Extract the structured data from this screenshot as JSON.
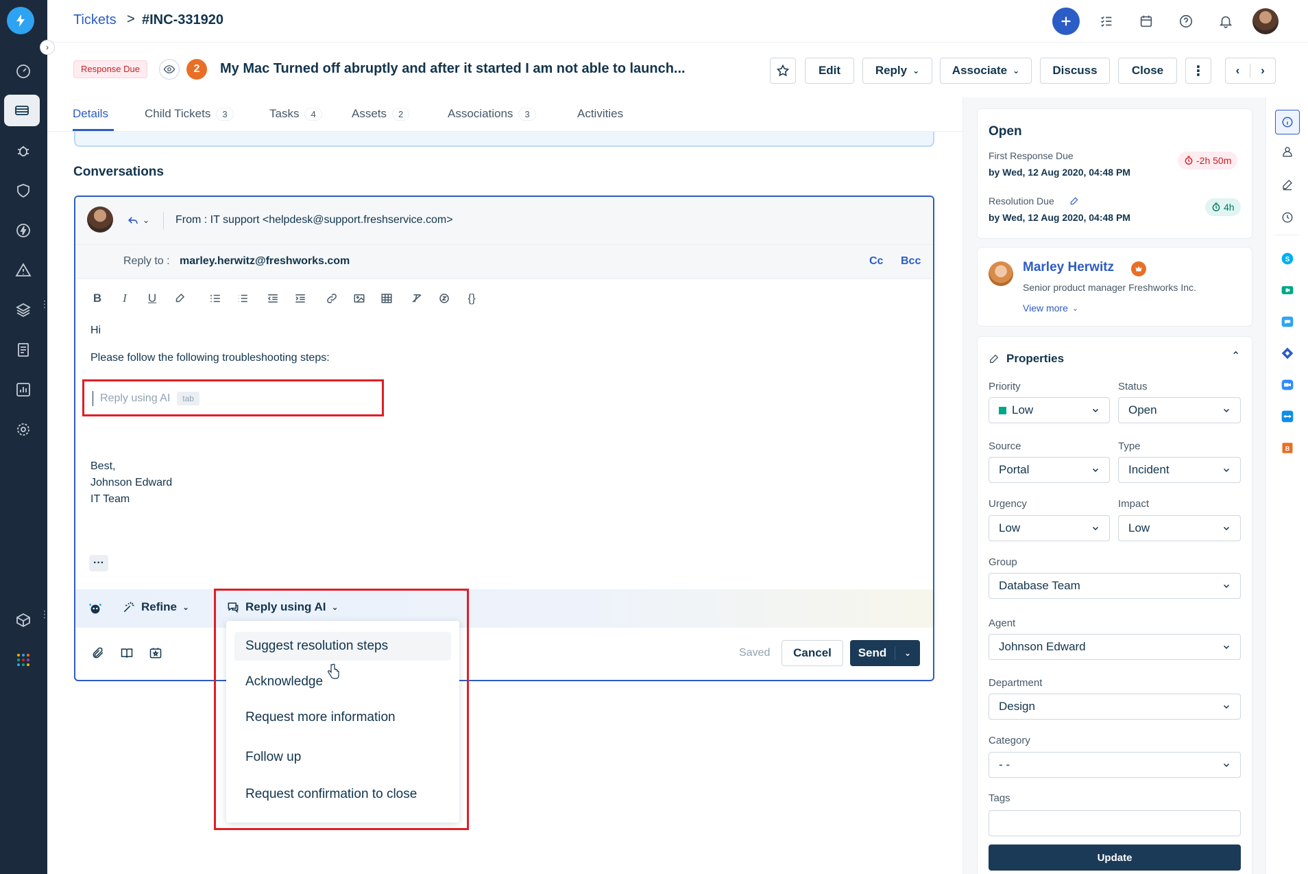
{
  "breadcrumb": {
    "root": "Tickets",
    "separator": ">",
    "current": "#INC-331920"
  },
  "ticket": {
    "badge": "Response Due",
    "watchers_count": "2",
    "title": "My Mac Turned off abruptly and after it started I am not able to launch..."
  },
  "toolbar": {
    "edit": "Edit",
    "reply": "Reply",
    "associate": "Associate",
    "discuss": "Discuss",
    "close": "Close"
  },
  "tabs": [
    {
      "label": "Details",
      "count": ""
    },
    {
      "label": "Child Tickets",
      "count": "3"
    },
    {
      "label": "Tasks",
      "count": "4"
    },
    {
      "label": "Assets",
      "count": "2"
    },
    {
      "label": "Associations",
      "count": "3"
    },
    {
      "label": "Activities",
      "count": ""
    }
  ],
  "conversations": {
    "title": "Conversations",
    "from": "From : IT support <helpdesk@support.freshservice.com>",
    "reply_to_label": "Reply to : ",
    "reply_to": "marley.herwitz@freshworks.com",
    "cc": "Cc",
    "bcc": "Bcc",
    "body": {
      "greeting": "Hi",
      "line1": "Please follow the following troubleshooting steps:",
      "ai_placeholder": "Reply using AI",
      "ai_hint": "tab",
      "sign1": "Best,",
      "sign2": "Johnson Edward",
      "sign3": "IT Team"
    },
    "ai_bar": {
      "refine": "Refine",
      "reply_ai": "Reply using AI"
    },
    "footer": {
      "saved": "Saved",
      "cancel": "Cancel",
      "send": "Send"
    }
  },
  "ai_menu": [
    "Suggest resolution steps",
    "Acknowledge",
    "Request more information",
    "Follow up",
    "Request confirmation to close"
  ],
  "status_card": {
    "status": "Open",
    "first_response_label": "First Response Due",
    "first_response_value": "by Wed, 12 Aug 2020, 04:48 PM",
    "first_response_badge": "-2h 50m",
    "resolution_label": "Resolution Due",
    "resolution_value": "by Wed, 12 Aug 2020, 04:48 PM",
    "resolution_badge": "4h"
  },
  "requester": {
    "name": "Marley Herwitz",
    "role": "Senior product manager Freshworks Inc.",
    "view_more": "View more"
  },
  "properties": {
    "title": "Properties",
    "priority_label": "Priority",
    "priority": "Low",
    "status_label": "Status",
    "status": "Open",
    "source_label": "Source",
    "source": "Portal",
    "type_label": "Type",
    "type": "Incident",
    "urgency_label": "Urgency",
    "urgency": "Low",
    "impact_label": "Impact",
    "impact": "Low",
    "group_label": "Group",
    "group": "Database Team",
    "agent_label": "Agent",
    "agent": "Johnson Edward",
    "department_label": "Department",
    "department": "Design",
    "category_label": "Category",
    "category": "- -",
    "tags_label": "Tags",
    "tags": "",
    "update": "Update"
  },
  "colors": {
    "nav_bg": "#1b2a3c",
    "accent": "#2c5cc5",
    "highlight": "#e11d24",
    "priority_low": "#00a886",
    "send_bg": "#1b3a57"
  }
}
